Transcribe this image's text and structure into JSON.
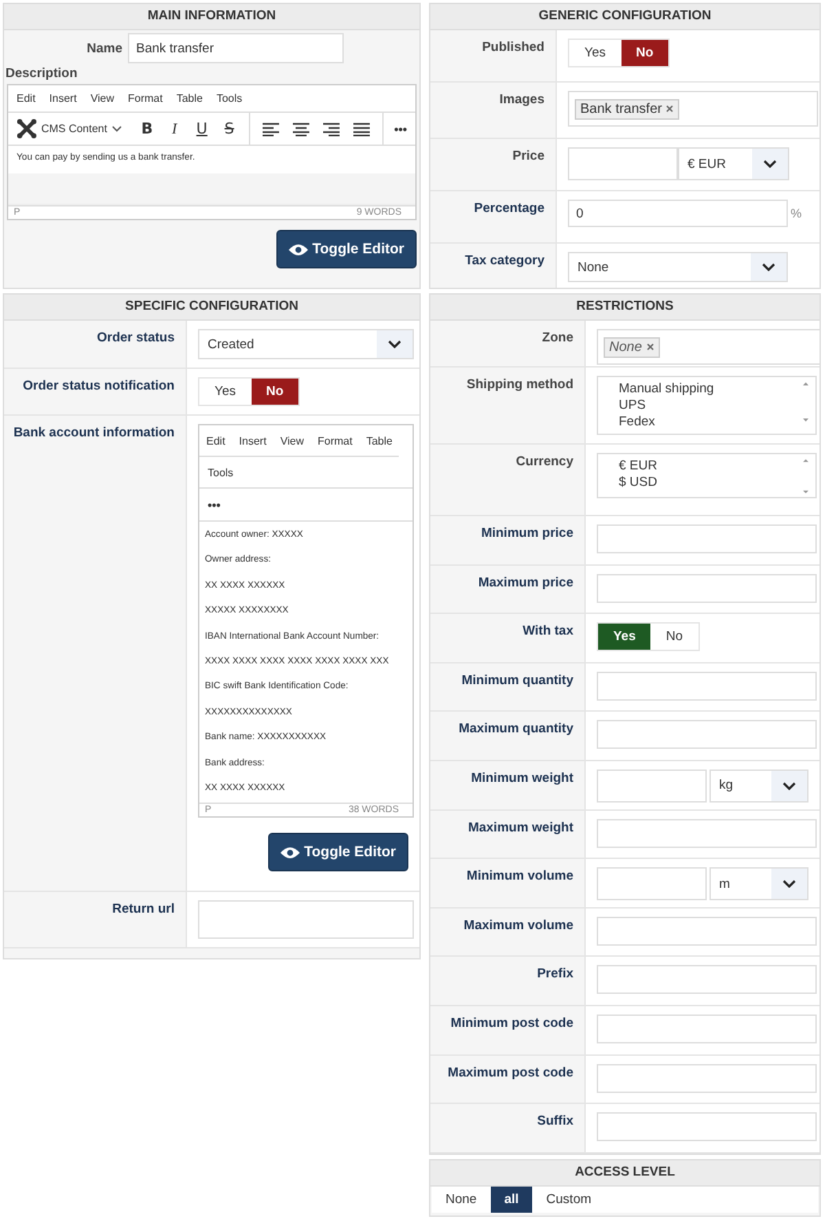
{
  "main_information": {
    "title": "MAIN INFORMATION",
    "name_label": "Name",
    "name_value": "Bank transfer",
    "description_label": "Description",
    "editor": {
      "menu": [
        "Edit",
        "Insert",
        "View",
        "Format",
        "Table",
        "Tools"
      ],
      "format_label": "CMS Content",
      "format_buttons": [
        {
          "kind": "bold",
          "label": "B"
        },
        {
          "kind": "italic",
          "label": "I"
        },
        {
          "kind": "underline",
          "label": "U"
        },
        {
          "kind": "strike",
          "label": "S"
        }
      ],
      "more": "•••",
      "content": [
        "You can pay by sending us a bank transfer."
      ],
      "path": "P",
      "word_count": "9 WORDS"
    },
    "toggle_button": "Toggle Editor"
  },
  "generic_configuration": {
    "title": "GENERIC CONFIGURATION",
    "rows": [
      {
        "kind": "toggle",
        "label": "Published",
        "accent": false,
        "options": [
          {
            "label": "Yes",
            "selected": false
          },
          {
            "label": "No",
            "selected": true
          }
        ]
      },
      {
        "kind": "tags",
        "label": "Images",
        "accent": false,
        "tags": [
          {
            "label": "Bank transfer",
            "italic": false
          }
        ]
      },
      {
        "kind": "input_select",
        "label": "Price",
        "accent": false,
        "value": "",
        "unit": "€ EUR"
      },
      {
        "kind": "input_suffix",
        "label": "Percentage",
        "accent": true,
        "value": "0",
        "suffix": "%"
      },
      {
        "kind": "select",
        "label": "Tax category",
        "accent": true,
        "value": "None"
      }
    ]
  },
  "specific_configuration": {
    "title": "SPECIFIC CONFIGURATION",
    "rows": [
      {
        "kind": "select",
        "label": "Order status",
        "accent": true,
        "value": "Created"
      },
      {
        "kind": "toggle",
        "label": "Order status notification",
        "accent": true,
        "options": [
          {
            "label": "Yes",
            "selected": false
          },
          {
            "label": "No",
            "selected": true
          }
        ]
      },
      {
        "kind": "editor",
        "label": "Bank account information",
        "accent": true,
        "menu": [
          "Edit",
          "Insert",
          "View",
          "Format",
          "Table",
          "Tools"
        ],
        "more": "•••",
        "content": [
          "Account owner: XXXXX",
          "Owner address:",
          "XX XXXX XXXXXX",
          "XXXXX XXXXXXXX",
          "IBAN International Bank Account Number:",
          "XXXX XXXX XXXX XXXX XXXX XXXX XXX",
          "BIC swift Bank Identification Code:",
          "XXXXXXXXXXXXXX",
          "Bank name: XXXXXXXXXXX",
          "Bank address:",
          "XX XXXX XXXXXX"
        ],
        "path": "P",
        "word_count": "38 WORDS",
        "toggle_button": "Toggle Editor"
      },
      {
        "kind": "text",
        "label": "Return url",
        "accent": true,
        "value": ""
      }
    ]
  },
  "restrictions": {
    "title": "RESTRICTIONS",
    "rows": [
      {
        "kind": "tags",
        "label": "Zone",
        "accent": false,
        "tags": [
          {
            "label": "None",
            "italic": true
          }
        ]
      },
      {
        "kind": "listbox",
        "label": "Shipping method",
        "accent": false,
        "items": [
          "Manual shipping",
          "UPS",
          "Fedex"
        ]
      },
      {
        "kind": "listbox",
        "label": "Currency",
        "accent": false,
        "items": [
          "€ EUR",
          "$ USD"
        ]
      },
      {
        "kind": "text",
        "label": "Minimum price",
        "accent": true,
        "value": ""
      },
      {
        "kind": "text",
        "label": "Maximum price",
        "accent": true,
        "value": ""
      },
      {
        "kind": "toggle",
        "label": "With tax",
        "accent": true,
        "options": [
          {
            "label": "Yes",
            "selected": true
          },
          {
            "label": "No",
            "selected": false
          }
        ]
      },
      {
        "kind": "text",
        "label": "Minimum quantity",
        "accent": true,
        "value": ""
      },
      {
        "kind": "text",
        "label": "Maximum quantity",
        "accent": true,
        "value": ""
      },
      {
        "kind": "input_select",
        "label": "Minimum weight",
        "accent": true,
        "value": "",
        "unit": "kg"
      },
      {
        "kind": "text",
        "label": "Maximum weight",
        "accent": true,
        "value": ""
      },
      {
        "kind": "input_select",
        "label": "Minimum volume",
        "accent": true,
        "value": "",
        "unit": "m"
      },
      {
        "kind": "text",
        "label": "Maximum volume",
        "accent": true,
        "value": ""
      },
      {
        "kind": "text",
        "label": "Prefix",
        "accent": true,
        "value": ""
      },
      {
        "kind": "text",
        "label": "Minimum post code",
        "accent": true,
        "value": ""
      },
      {
        "kind": "text",
        "label": "Maximum post code",
        "accent": true,
        "value": ""
      },
      {
        "kind": "text",
        "label": "Suffix",
        "accent": true,
        "value": ""
      }
    ]
  },
  "access_level": {
    "title": "ACCESS LEVEL",
    "options": [
      {
        "label": "None",
        "selected": false
      },
      {
        "label": "all",
        "selected": true
      },
      {
        "label": "Custom",
        "selected": false
      }
    ]
  }
}
